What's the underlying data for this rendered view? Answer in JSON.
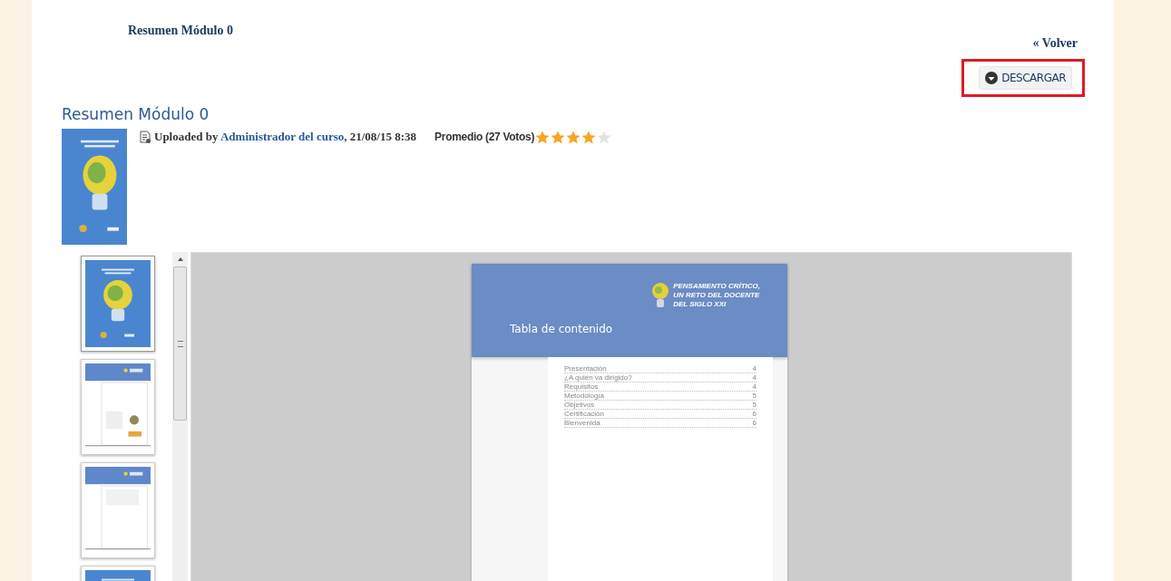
{
  "breadcrumb_title": "Resumen Módulo 0",
  "back_link": "« Volver",
  "download_button": {
    "label": "DESCARGAR",
    "highlighted": true
  },
  "document": {
    "title": "Resumen Módulo 0",
    "uploaded_prefix": "Uploaded by",
    "uploader": "Administrador del curso",
    "uploaded_date": ", 21/08/15 8:38",
    "rating_label": "Promedio (27 Votos)",
    "stars": 4
  },
  "viewer": {
    "thumbnails": [
      {
        "kind": "cover",
        "selected": true
      },
      {
        "kind": "credits",
        "selected": false
      },
      {
        "kind": "contents",
        "selected": false
      },
      {
        "kind": "cover",
        "selected": false
      }
    ],
    "page": {
      "header_title": "PENSAMIENTO CRÍTICO,\nUN RETO DEL DOCENTE\nDEL SIGLO XXI",
      "heading": "Tabla de contenido",
      "toc": [
        {
          "entry": "Presentación",
          "page": "4"
        },
        {
          "entry": "¿A quién va dirigido?",
          "page": "4"
        },
        {
          "entry": "Requisitos",
          "page": "4"
        },
        {
          "entry": "Metodología",
          "page": "5"
        },
        {
          "entry": "Objetivos",
          "page": "5"
        },
        {
          "entry": "Certificación",
          "page": "6"
        },
        {
          "entry": "Bienvenida",
          "page": "6"
        }
      ]
    }
  }
}
